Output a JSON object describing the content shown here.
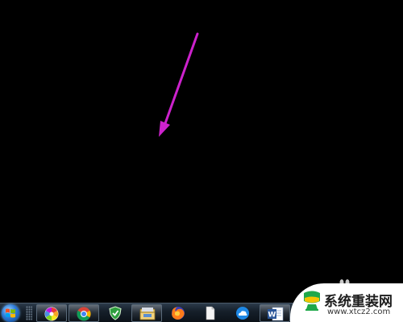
{
  "desktop": {
    "background_color": "#000000",
    "annotation": {
      "type": "arrow",
      "color": "#cc22cc",
      "direction": "down-left"
    }
  },
  "taskbar": {
    "start_button": {
      "icon": "windows-start-orb-icon"
    },
    "pinned_apps": [
      {
        "name": "photo-viewer",
        "icon": "colorful-pinwheel-icon",
        "active": true
      },
      {
        "name": "chrome",
        "icon": "chrome-icon",
        "active": true
      },
      {
        "name": "security",
        "icon": "green-shield-icon",
        "active": false
      },
      {
        "name": "file-explorer",
        "icon": "folder-library-icon",
        "active": true
      },
      {
        "name": "firefox",
        "icon": "firefox-icon",
        "active": false
      },
      {
        "name": "blank-file",
        "icon": "blank-document-icon",
        "active": false
      },
      {
        "name": "cloud-app",
        "icon": "blue-cloud-circle-icon",
        "active": false
      },
      {
        "name": "word",
        "icon": "word-document-icon",
        "active": true
      }
    ]
  },
  "watermark": {
    "title": "系统重装网",
    "url": "www.xtcz2.com",
    "logo_icon": "green-monitor-logo-icon",
    "colors": {
      "green": "#1fa84a",
      "yellow": "#f5c400"
    }
  }
}
